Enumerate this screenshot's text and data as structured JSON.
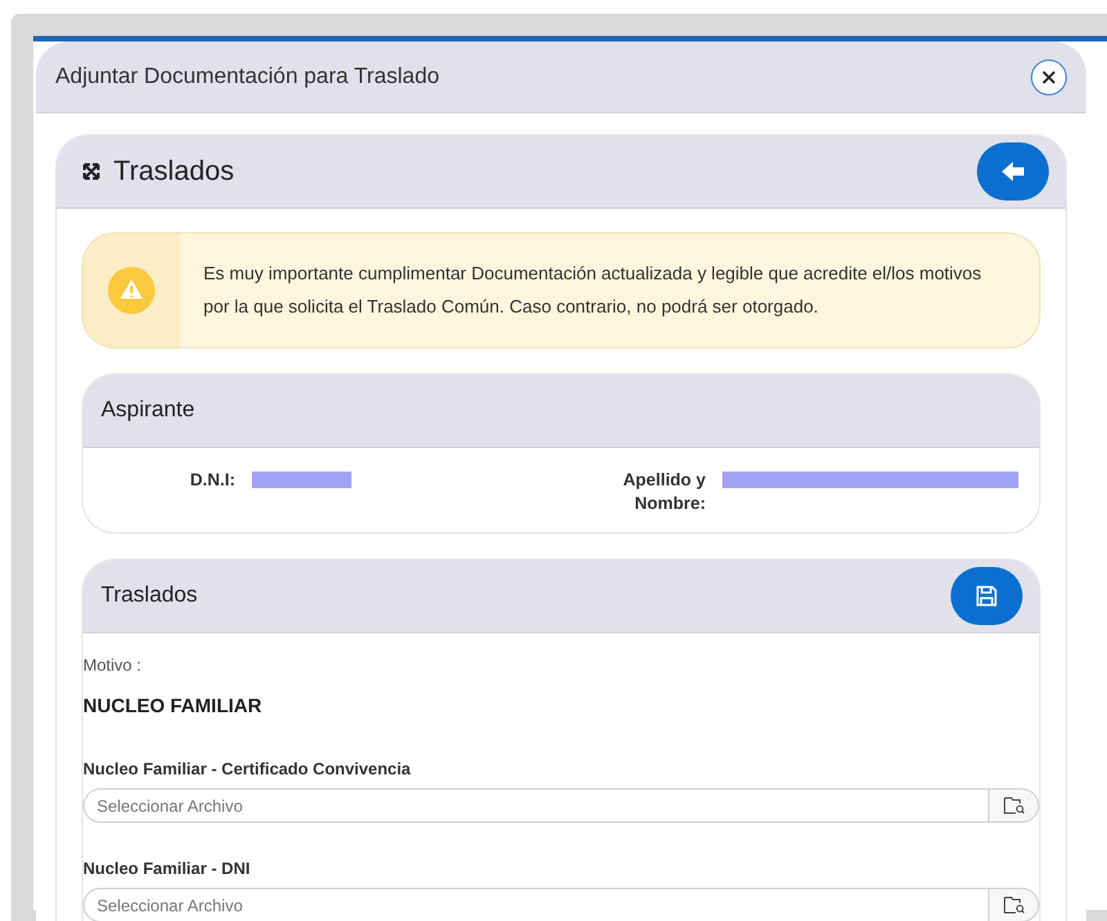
{
  "dialog": {
    "title": "Adjuntar Documentación para Traslado"
  },
  "panel": {
    "title": "Traslados"
  },
  "alert": {
    "message": "Es muy importante cumplimentar Documentación actualizada y legible que acredite el/los motivos por la que solicita el Traslado Común. Caso contrario, no podrá ser otorgado."
  },
  "applicant": {
    "title": "Aspirante",
    "fields": [
      {
        "label": "D.N.I:"
      },
      {
        "label": "Apellido y Nombre:"
      }
    ]
  },
  "transfers": {
    "title": "Traslados",
    "reason_label": "Motivo :",
    "reason": "NUCLEO FAMILIAR",
    "files": [
      {
        "label": "Nucleo Familiar - Certificado Convivencia",
        "placeholder": "Seleccionar Archivo"
      },
      {
        "label": "Nucleo Familiar - DNI",
        "placeholder": "Seleccionar Archivo"
      }
    ]
  }
}
